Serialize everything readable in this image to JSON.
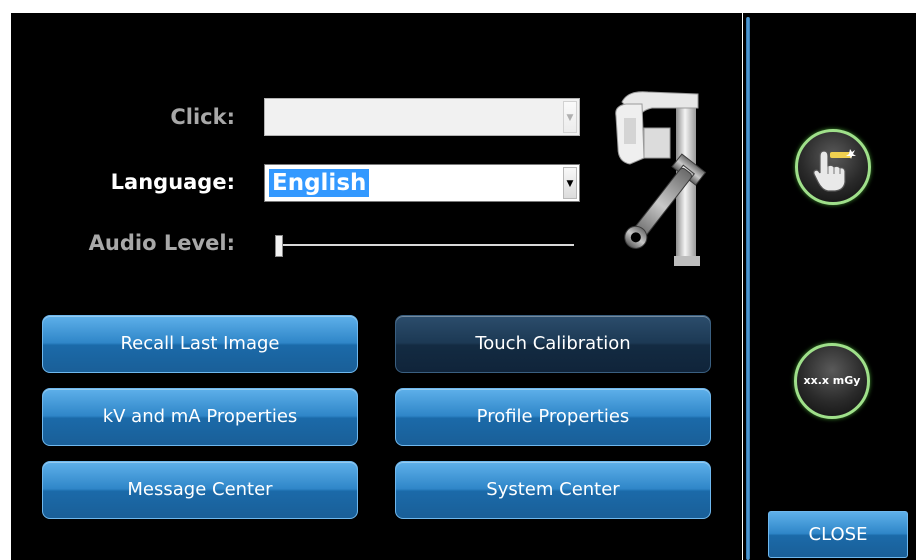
{
  "settings": {
    "click_label": "Click:",
    "click_value": "",
    "language_label": "Language:",
    "language_value": "English",
    "audio_label": "Audio Level:",
    "audio_level": 0.0
  },
  "buttons": {
    "recall_last_image": "Recall Last Image",
    "touch_calibration": "Touch Calibration",
    "kv_ma_properties": "kV and mA Properties",
    "profile_properties": "Profile Properties",
    "message_center": "Message Center",
    "system_center": "System Center"
  },
  "side_panel": {
    "dose_label": "xx.x mGy",
    "close_label": "CLOSE"
  },
  "icons": {
    "pointer": "hand-pointer-icon",
    "device": "xray-unit-wrench-icon",
    "dropdown": "chevron-down-icon"
  },
  "colors": {
    "background": "#000000",
    "button_blue": "#2f86c8",
    "button_dark": "#1c3954",
    "selection": "#3399ff",
    "ring_green": "#9fe08a"
  }
}
